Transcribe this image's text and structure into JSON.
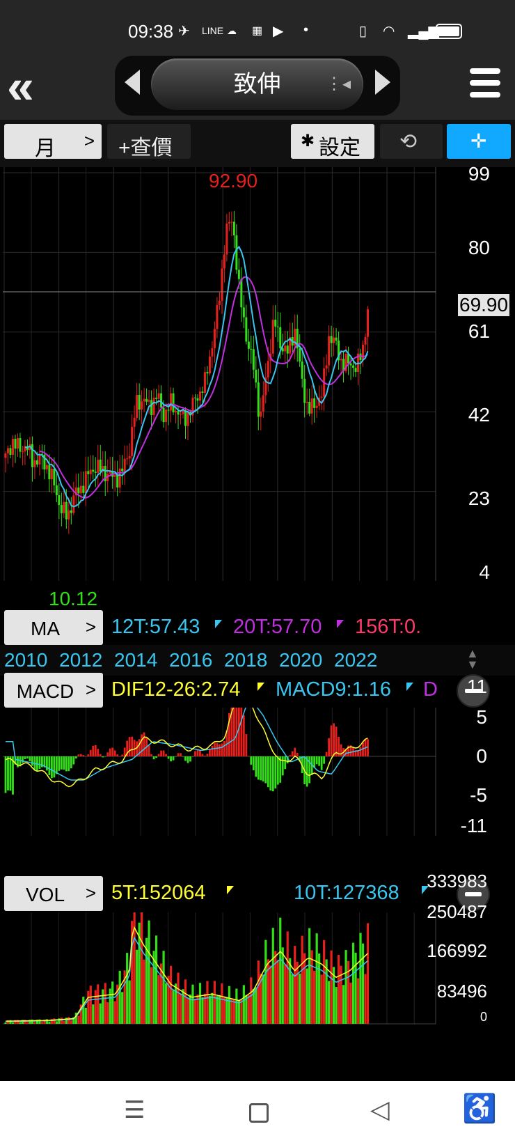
{
  "status": {
    "time": "09:38",
    "signal_icons": [
      "telegram-icon",
      "line-icon",
      "gomaji-icon",
      "sim-icon",
      "youtube-icon",
      "dot-icon"
    ],
    "right_icons": [
      "vibrate-icon",
      "wifi-icon",
      "signal-icon",
      "battery-icon"
    ]
  },
  "header": {
    "title": "致伸",
    "back_label": "«",
    "menu_icon": "hamburger-icon"
  },
  "toolbar": {
    "period": "月",
    "period_chevron": ">",
    "query": "+查價",
    "settings": "設定",
    "settings_icon": "gear-icon",
    "rotate_icon": "rotate-icon",
    "collapse_icon": "collapse-icon"
  },
  "price_chart": {
    "high_label": "92.90",
    "low_label": "10.12",
    "current_label": "69.90",
    "y_ticks": [
      "99",
      "80",
      "61",
      "42",
      "23",
      "4"
    ]
  },
  "ma_bar": {
    "label": "MA",
    "chevron": ">",
    "ma12": "12T:57.43",
    "ma20": "20T:57.70",
    "ma156": "156T:0."
  },
  "years": [
    "2010",
    "2012",
    "2014",
    "2016",
    "2018",
    "2020",
    "2022"
  ],
  "macd_bar": {
    "label": "MACD",
    "chevron": ">",
    "dif": "DIF12-26:2.74",
    "macd9": "MACD9:1.16",
    "d": "D"
  },
  "macd_ticks": [
    "11",
    "5",
    "0",
    "-5",
    "-11"
  ],
  "vol_bar": {
    "label": "VOL",
    "chevron": ">",
    "t5": "5T:152064",
    "t10": "10T:127368"
  },
  "vol_ticks": [
    "333983",
    "250487",
    "166992",
    "83496",
    "0"
  ],
  "colors": {
    "up": "#e8201c",
    "down": "#33e018",
    "ma12": "#39c6f0",
    "ma20": "#c030e0",
    "ma156": "#ff3a6a",
    "dif": "#ffff33",
    "macd9": "#39c6f0",
    "accent": "#11a8ff"
  },
  "chart_data": {
    "type": "line",
    "title": "",
    "x": [
      "2010",
      "2012",
      "2014",
      "2016",
      "2018",
      "2020",
      "2022"
    ],
    "series": [
      {
        "name": "12T",
        "values": [
          34,
          22,
          30,
          41,
          60,
          52,
          57.43
        ]
      },
      {
        "name": "20T",
        "values": [
          33,
          24,
          28,
          38,
          56,
          53,
          57.7
        ]
      }
    ],
    "ylim": [
      4,
      99
    ],
    "extremes": {
      "high": 92.9,
      "low": 10.12,
      "current": 69.9
    }
  }
}
